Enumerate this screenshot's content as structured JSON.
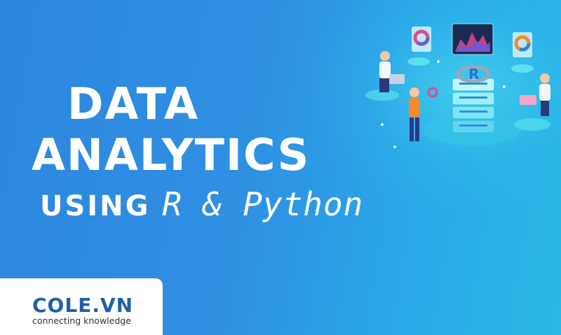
{
  "headline": {
    "line1": "DATA",
    "line2": "ANALYTICS",
    "line3_prefix": "USING",
    "line3_script": "R & Python"
  },
  "brand": {
    "name": "COLE.VN",
    "tagline": "connecting knowledge"
  },
  "illustration": {
    "server_badge": "R"
  },
  "colors": {
    "background": "#2f8fe0",
    "brand_blue": "#1f5fa8",
    "accent_cyan": "#3fe0e8",
    "accent_orange": "#f08a2c"
  }
}
